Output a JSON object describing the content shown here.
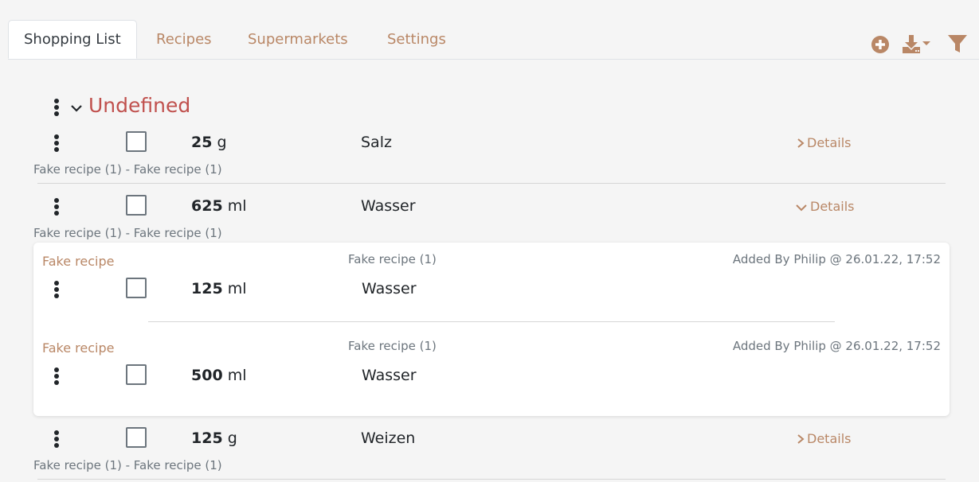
{
  "tabs": [
    {
      "label": "Shopping List",
      "active": true
    },
    {
      "label": "Recipes"
    },
    {
      "label": "Supermarkets"
    },
    {
      "label": "Settings"
    }
  ],
  "toolbar": {
    "add_icon": "plus-circle-icon",
    "download_icon": "download-dropdown-icon",
    "filter_icon": "filter-icon"
  },
  "category": {
    "name": "Undefined",
    "expanded": true
  },
  "entries": [
    {
      "amount": "25",
      "unit": "g",
      "food": "Salz",
      "details_label": "Details",
      "expanded": false,
      "recipes": "Fake recipe (1) - Fake recipe (1)"
    },
    {
      "amount": "625",
      "unit": "ml",
      "food": "Wasser",
      "details_label": "Details",
      "expanded": true,
      "recipes": "Fake recipe (1) - Fake recipe (1)",
      "sub_items": [
        {
          "recipe_link": "Fake recipe",
          "recipe_ref": "Fake recipe (1)",
          "added_by": "Added By Philip @ 26.01.22, 17:52",
          "amount": "125",
          "unit": "ml",
          "food": "Wasser"
        },
        {
          "recipe_link": "Fake recipe",
          "recipe_ref": "Fake recipe (1)",
          "added_by": "Added By Philip @ 26.01.22, 17:52",
          "amount": "500",
          "unit": "ml",
          "food": "Wasser"
        }
      ]
    },
    {
      "amount": "125",
      "unit": "g",
      "food": "Weizen",
      "details_label": "Details",
      "expanded": false,
      "recipes": "Fake recipe (1) - Fake recipe (1)"
    }
  ],
  "colors": {
    "accent": "#b98766",
    "category": "#c0504d",
    "background": "#f5f5f5"
  }
}
